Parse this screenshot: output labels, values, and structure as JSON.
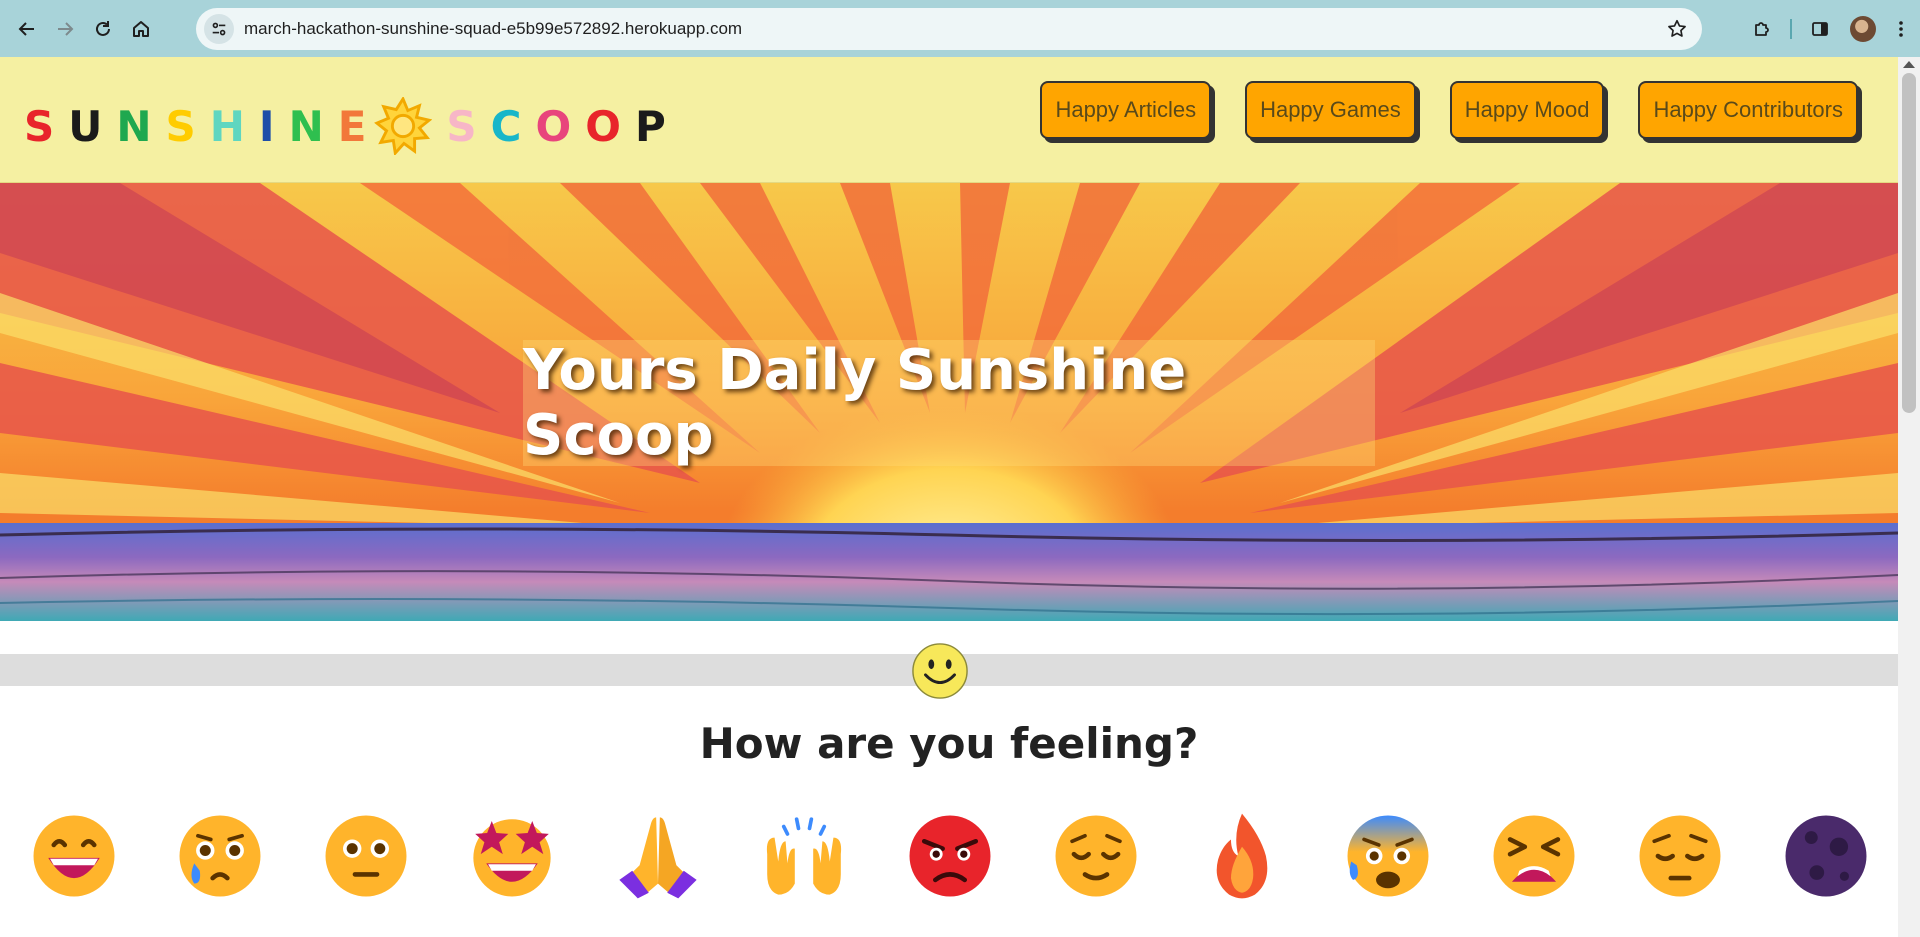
{
  "browser": {
    "url": "march-hackathon-sunshine-squad-e5b99e572892.herokuapp.com"
  },
  "site": {
    "logo_letters_left": [
      "S",
      "U",
      "N",
      "S",
      "H",
      "I",
      "N",
      "E"
    ],
    "logo_letters_right": [
      "S",
      "C",
      "O",
      "O",
      "P"
    ],
    "logo_colors_left": [
      "#e8242b",
      "#1b1b1b",
      "#1fa84f",
      "#ffcc00",
      "#5fd6c0",
      "#1e4fa8",
      "#2fbf4f",
      "#f2783a"
    ],
    "logo_colors_right": [
      "#f7b6c7",
      "#18b6c9",
      "#e8457c",
      "#e8242b",
      "#1b1b1b"
    ],
    "nav": [
      {
        "label": "Happy Articles"
      },
      {
        "label": "Happy Games"
      },
      {
        "label": "Happy Mood"
      },
      {
        "label": "Happy Contributors"
      }
    ]
  },
  "hero": {
    "title": "Yours Daily Sunshine Scoop"
  },
  "mood": {
    "title": "How are you feeling?",
    "emojis": [
      "grinning-face-icon",
      "sad-but-relieved-face-icon",
      "face-without-mouth-icon",
      "star-struck-icon",
      "folded-hands-icon",
      "raising-hands-icon",
      "angry-face-icon",
      "relieved-face-icon",
      "fire-icon",
      "anxious-face-icon",
      "tired-face-icon",
      "pensive-face-icon",
      "new-moon-icon"
    ]
  },
  "colors": {
    "header_bg": "#f5f0a2",
    "button_bg": "#ffa500",
    "divider": "#dddddd"
  }
}
